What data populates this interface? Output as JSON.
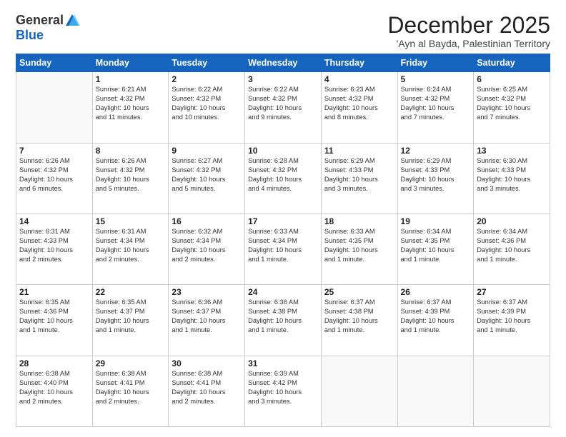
{
  "logo": {
    "general": "General",
    "blue": "Blue"
  },
  "title": "December 2025",
  "subtitle": "'Ayn al Bayda, Palestinian Territory",
  "weekdays": [
    "Sunday",
    "Monday",
    "Tuesday",
    "Wednesday",
    "Thursday",
    "Friday",
    "Saturday"
  ],
  "weeks": [
    [
      {
        "day": "",
        "info": ""
      },
      {
        "day": "1",
        "info": "Sunrise: 6:21 AM\nSunset: 4:32 PM\nDaylight: 10 hours\nand 11 minutes."
      },
      {
        "day": "2",
        "info": "Sunrise: 6:22 AM\nSunset: 4:32 PM\nDaylight: 10 hours\nand 10 minutes."
      },
      {
        "day": "3",
        "info": "Sunrise: 6:22 AM\nSunset: 4:32 PM\nDaylight: 10 hours\nand 9 minutes."
      },
      {
        "day": "4",
        "info": "Sunrise: 6:23 AM\nSunset: 4:32 PM\nDaylight: 10 hours\nand 8 minutes."
      },
      {
        "day": "5",
        "info": "Sunrise: 6:24 AM\nSunset: 4:32 PM\nDaylight: 10 hours\nand 7 minutes."
      },
      {
        "day": "6",
        "info": "Sunrise: 6:25 AM\nSunset: 4:32 PM\nDaylight: 10 hours\nand 7 minutes."
      }
    ],
    [
      {
        "day": "7",
        "info": "Sunrise: 6:26 AM\nSunset: 4:32 PM\nDaylight: 10 hours\nand 6 minutes."
      },
      {
        "day": "8",
        "info": "Sunrise: 6:26 AM\nSunset: 4:32 PM\nDaylight: 10 hours\nand 5 minutes."
      },
      {
        "day": "9",
        "info": "Sunrise: 6:27 AM\nSunset: 4:32 PM\nDaylight: 10 hours\nand 5 minutes."
      },
      {
        "day": "10",
        "info": "Sunrise: 6:28 AM\nSunset: 4:32 PM\nDaylight: 10 hours\nand 4 minutes."
      },
      {
        "day": "11",
        "info": "Sunrise: 6:29 AM\nSunset: 4:33 PM\nDaylight: 10 hours\nand 3 minutes."
      },
      {
        "day": "12",
        "info": "Sunrise: 6:29 AM\nSunset: 4:33 PM\nDaylight: 10 hours\nand 3 minutes."
      },
      {
        "day": "13",
        "info": "Sunrise: 6:30 AM\nSunset: 4:33 PM\nDaylight: 10 hours\nand 3 minutes."
      }
    ],
    [
      {
        "day": "14",
        "info": "Sunrise: 6:31 AM\nSunset: 4:33 PM\nDaylight: 10 hours\nand 2 minutes."
      },
      {
        "day": "15",
        "info": "Sunrise: 6:31 AM\nSunset: 4:34 PM\nDaylight: 10 hours\nand 2 minutes."
      },
      {
        "day": "16",
        "info": "Sunrise: 6:32 AM\nSunset: 4:34 PM\nDaylight: 10 hours\nand 2 minutes."
      },
      {
        "day": "17",
        "info": "Sunrise: 6:33 AM\nSunset: 4:34 PM\nDaylight: 10 hours\nand 1 minute."
      },
      {
        "day": "18",
        "info": "Sunrise: 6:33 AM\nSunset: 4:35 PM\nDaylight: 10 hours\nand 1 minute."
      },
      {
        "day": "19",
        "info": "Sunrise: 6:34 AM\nSunset: 4:35 PM\nDaylight: 10 hours\nand 1 minute."
      },
      {
        "day": "20",
        "info": "Sunrise: 6:34 AM\nSunset: 4:36 PM\nDaylight: 10 hours\nand 1 minute."
      }
    ],
    [
      {
        "day": "21",
        "info": "Sunrise: 6:35 AM\nSunset: 4:36 PM\nDaylight: 10 hours\nand 1 minute."
      },
      {
        "day": "22",
        "info": "Sunrise: 6:35 AM\nSunset: 4:37 PM\nDaylight: 10 hours\nand 1 minute."
      },
      {
        "day": "23",
        "info": "Sunrise: 6:36 AM\nSunset: 4:37 PM\nDaylight: 10 hours\nand 1 minute."
      },
      {
        "day": "24",
        "info": "Sunrise: 6:36 AM\nSunset: 4:38 PM\nDaylight: 10 hours\nand 1 minute."
      },
      {
        "day": "25",
        "info": "Sunrise: 6:37 AM\nSunset: 4:38 PM\nDaylight: 10 hours\nand 1 minute."
      },
      {
        "day": "26",
        "info": "Sunrise: 6:37 AM\nSunset: 4:39 PM\nDaylight: 10 hours\nand 1 minute."
      },
      {
        "day": "27",
        "info": "Sunrise: 6:37 AM\nSunset: 4:39 PM\nDaylight: 10 hours\nand 1 minute."
      }
    ],
    [
      {
        "day": "28",
        "info": "Sunrise: 6:38 AM\nSunset: 4:40 PM\nDaylight: 10 hours\nand 2 minutes."
      },
      {
        "day": "29",
        "info": "Sunrise: 6:38 AM\nSunset: 4:41 PM\nDaylight: 10 hours\nand 2 minutes."
      },
      {
        "day": "30",
        "info": "Sunrise: 6:38 AM\nSunset: 4:41 PM\nDaylight: 10 hours\nand 2 minutes."
      },
      {
        "day": "31",
        "info": "Sunrise: 6:39 AM\nSunset: 4:42 PM\nDaylight: 10 hours\nand 3 minutes."
      },
      {
        "day": "",
        "info": ""
      },
      {
        "day": "",
        "info": ""
      },
      {
        "day": "",
        "info": ""
      }
    ]
  ]
}
